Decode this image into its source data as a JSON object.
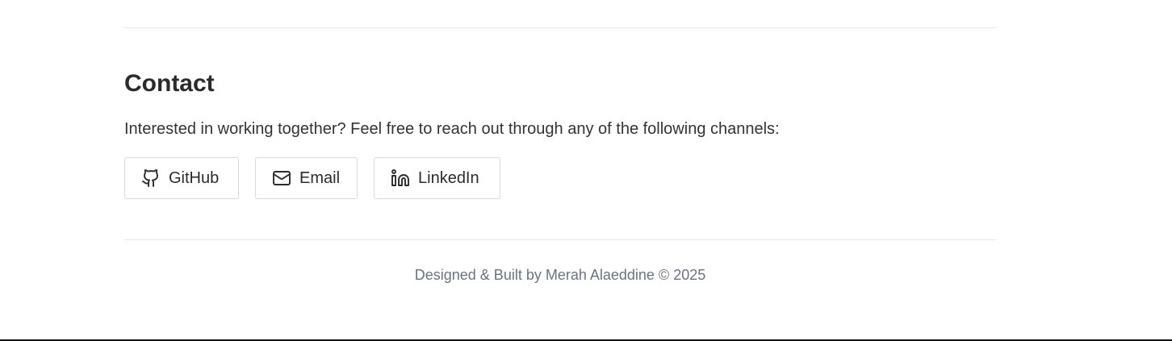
{
  "contact": {
    "title": "Contact",
    "intro": "Interested in working together? Feel free to reach out through any of the following channels:",
    "links": [
      {
        "label": "GitHub",
        "icon": "github-icon"
      },
      {
        "label": "Email",
        "icon": "mail-icon"
      },
      {
        "label": "LinkedIn",
        "icon": "linkedin-icon"
      }
    ]
  },
  "footer": {
    "text": "Designed & Built by Merah Alaeddine © 2025"
  },
  "colors": {
    "text": "#2b2b2b",
    "muted": "#6b7280",
    "border": "#d9d9d9",
    "divider": "#e7e7e7"
  }
}
